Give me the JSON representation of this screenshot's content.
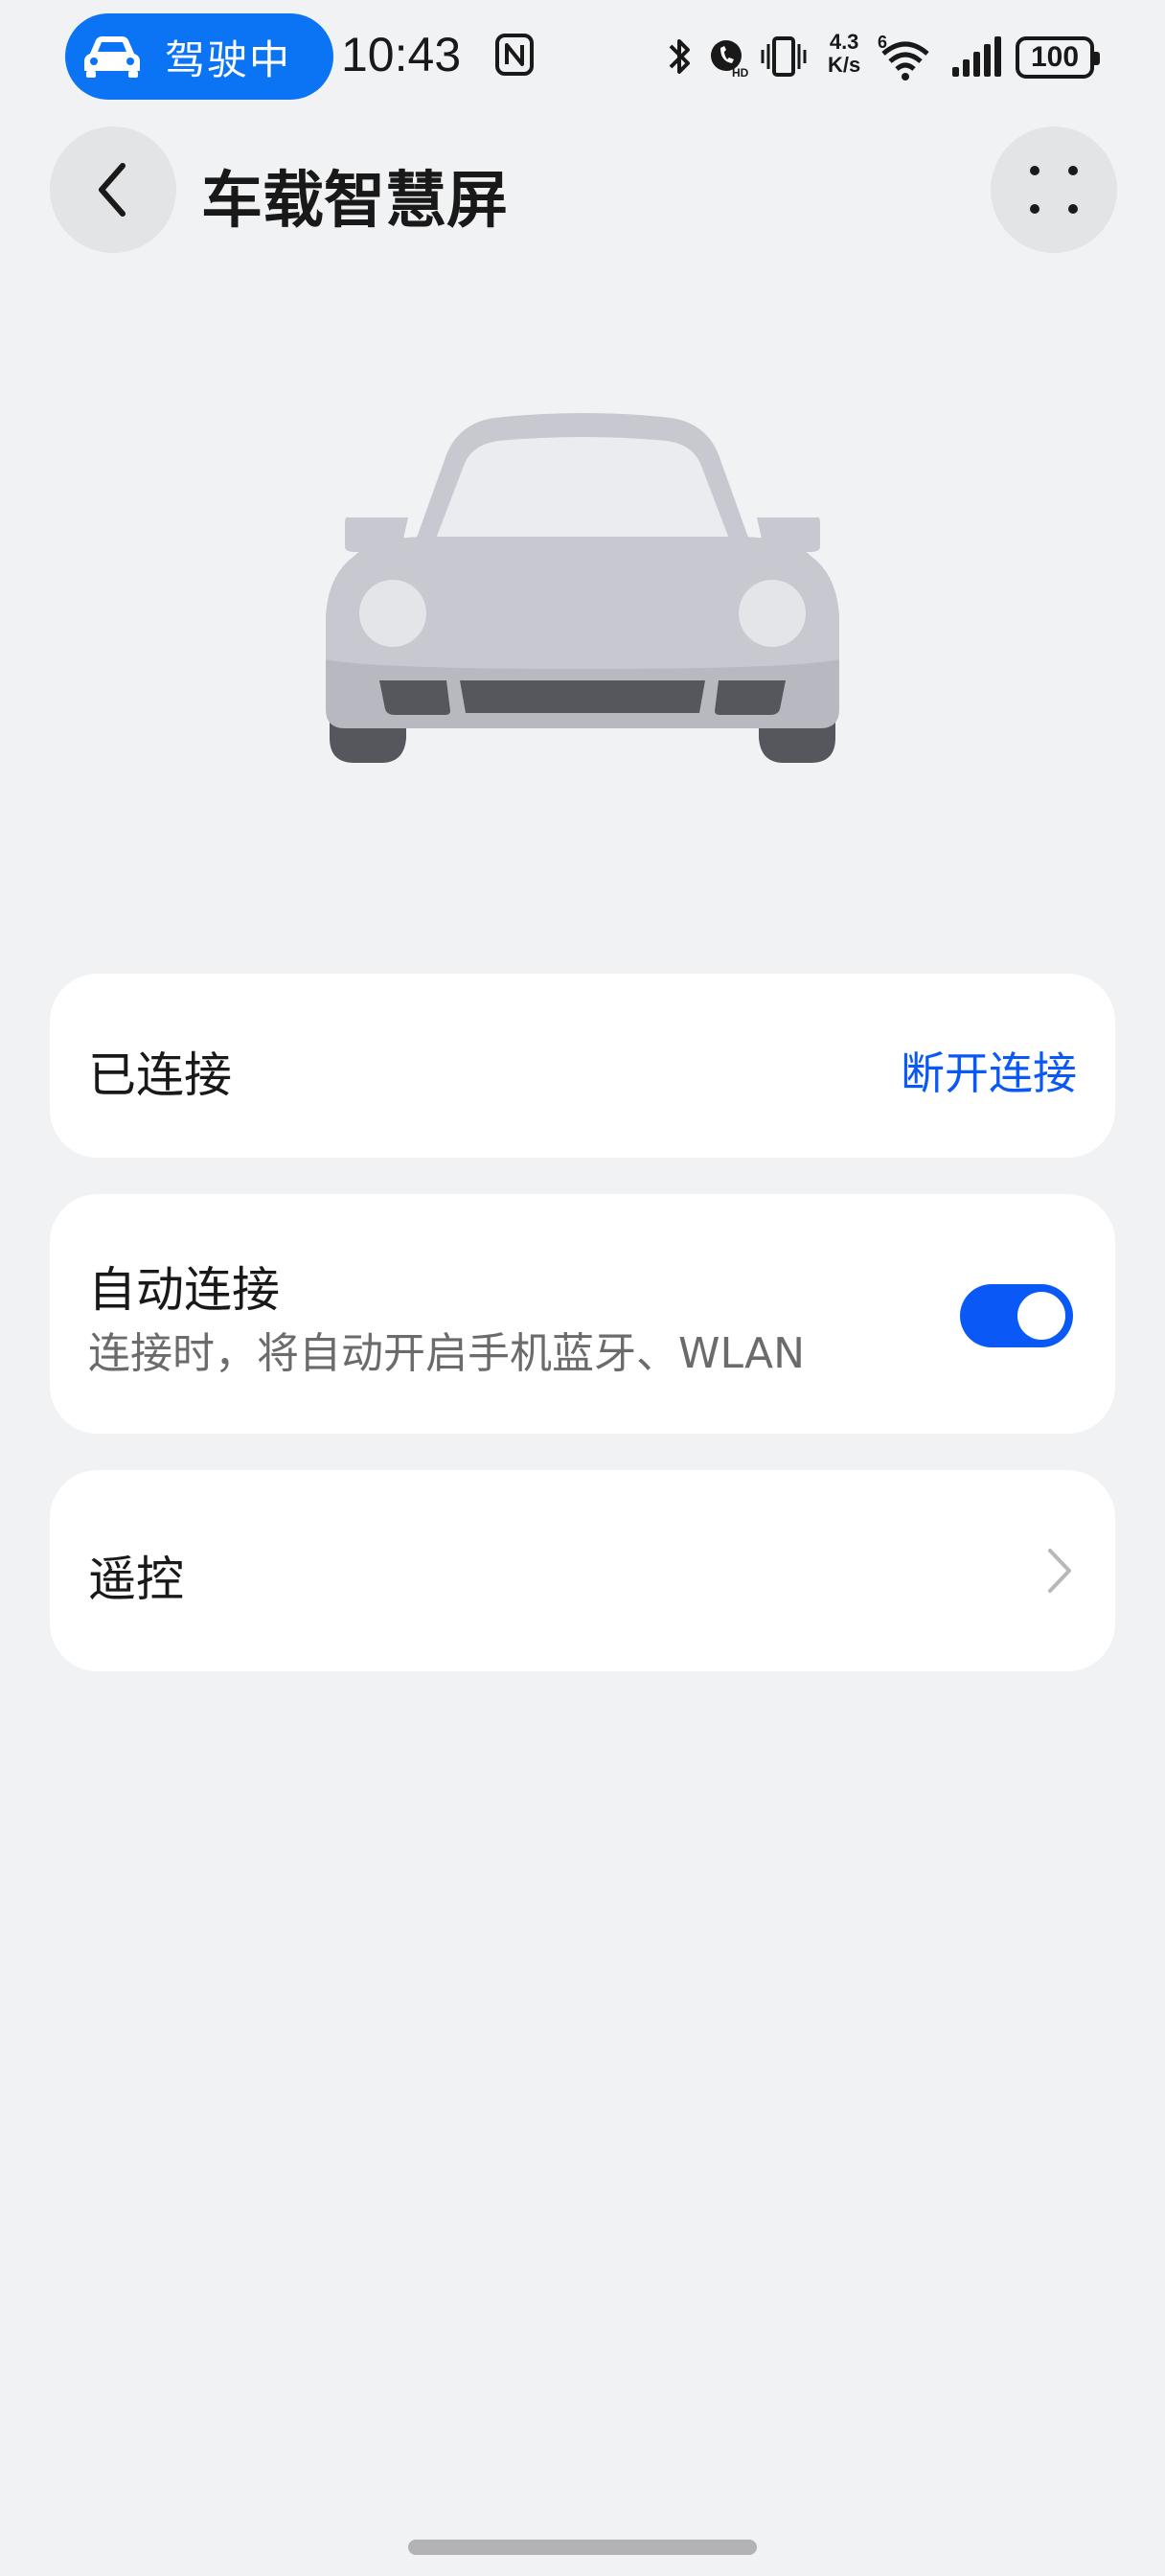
{
  "status_bar": {
    "driving_label": "驾驶中",
    "time": "10:43",
    "net_speed_value": "4.3",
    "net_speed_unit": "K/s",
    "wifi_label": "6",
    "battery": "100"
  },
  "header": {
    "title": "车载智慧屏"
  },
  "connection": {
    "status_label": "已连接",
    "disconnect_label": "断开连接"
  },
  "auto_connect": {
    "label": "自动连接",
    "description": "连接时，将自动开启手机蓝牙、WLAN",
    "enabled": true
  },
  "remote": {
    "label": "遥控"
  },
  "colors": {
    "accent": "#0a59f7",
    "pill": "#0a74f5",
    "background": "#f1f2f4"
  },
  "icons": [
    "car-icon",
    "nfc-icon",
    "bluetooth-icon",
    "hd-call-icon",
    "vibrate-icon",
    "wifi-icon",
    "signal-icon",
    "battery-icon",
    "back-arrow-icon",
    "more-dots-icon",
    "chevron-right-icon"
  ]
}
